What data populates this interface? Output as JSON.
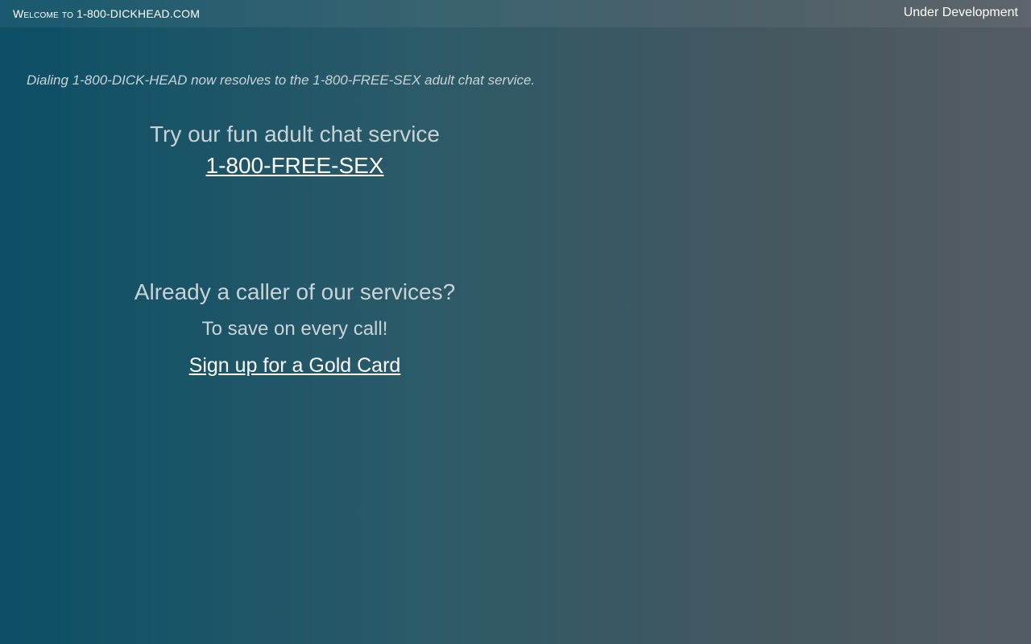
{
  "header": {
    "site_title": "Welcome to 1-800-DICKHEAD.COM",
    "status": "Under Development"
  },
  "notice": "Dialing 1-800-DICK-HEAD now resolves to the 1-800-FREE-SEX adult chat service.",
  "promo": {
    "heading": "Try our fun adult chat service",
    "link_label": "1-800-FREE-SEX"
  },
  "callers": {
    "heading": "Already a caller of our services?",
    "subheading": "To save on every call!",
    "link_label": "Sign up for a Gold Card"
  },
  "colors": {
    "background_left": "#0c4f66",
    "background_right": "#545c63",
    "text": "#c9d3d6",
    "link": "#ffffff"
  }
}
